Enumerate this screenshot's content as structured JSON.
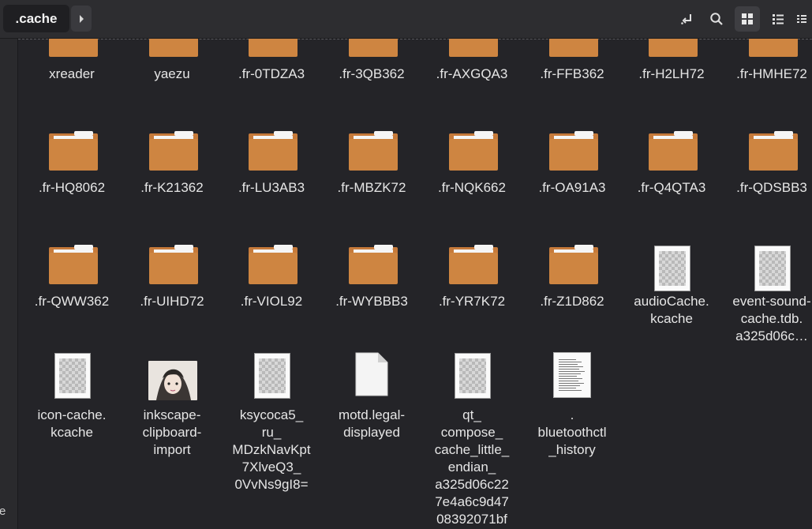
{
  "header": {
    "breadcrumb": ".cache",
    "icons": [
      "path-jump-icon",
      "search-icon",
      "grid-view-icon",
      "list-view-icon",
      "menu-icon"
    ]
  },
  "sidebar": {
    "fragment": "e"
  },
  "files": {
    "row1": [
      "xreader",
      "yaezu",
      ".fr-0TDZA3",
      ".fr-3QB362",
      ".fr-AXGQA3",
      ".fr-FFB362",
      ".fr-H2LH72",
      ".fr-HMHE72"
    ],
    "row2": [
      ".fr-HQ8062",
      ".fr-K21362",
      ".fr-LU3AB3",
      ".fr-MBZK72",
      ".fr-NQK662",
      ".fr-OA91A3",
      ".fr-Q4QTA3",
      ".fr-QDSBB3"
    ],
    "row3": [
      ".fr-QWW362",
      ".fr-UIHD72",
      ".fr-VIOL92",
      ".fr-WYBBB3",
      ".fr-YR7K72",
      ".fr-Z1D862",
      "audioCache.\nkcache",
      "event-sound-\ncache.tdb.\na325d06c…"
    ],
    "row4": [
      "icon-cache.\nkcache",
      "inkscape-\nclipboard-\nimport",
      "ksycoca5_\nru_\nMDzkNavKpt\n7XlveQ3_\n0VvNs9gI8=",
      "motd.legal-\ndisplayed",
      "qt_\ncompose_\ncache_little_\nendian_\na325d06c22\n7e4a6c9d47\n08392071bf",
      ".\nbluetoothctl\n_history"
    ]
  }
}
